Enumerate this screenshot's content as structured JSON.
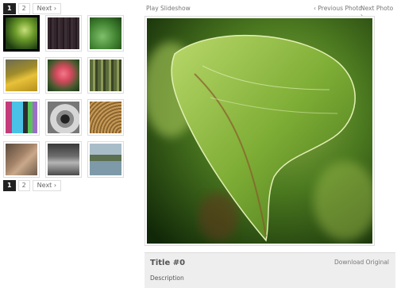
{
  "pagination": {
    "pages": [
      "1",
      "2"
    ],
    "active_page": "1",
    "next_label": "Next ›"
  },
  "thumbnails": [
    {
      "alt": "leaf",
      "selected": true
    },
    {
      "alt": "pink-purple texture"
    },
    {
      "alt": "green leaf"
    },
    {
      "alt": "yellow peppers"
    },
    {
      "alt": "red flower"
    },
    {
      "alt": "bamboo"
    },
    {
      "alt": "colored stripes"
    },
    {
      "alt": "camera lens"
    },
    {
      "alt": "wooden rings"
    },
    {
      "alt": "hands"
    },
    {
      "alt": "city at night"
    },
    {
      "alt": "waterfront landscape"
    }
  ],
  "toolbar": {
    "slideshow_label": "Play Slideshow",
    "prev_label": "‹ Previous Photo",
    "next_label": "Next Photo ›"
  },
  "caption": {
    "title": "Title #0",
    "download_label": "Download Original",
    "description": "Description"
  },
  "colors": {
    "active_page_bg": "#222222",
    "caption_bg": "#eeeeee",
    "border": "#dddddd"
  }
}
